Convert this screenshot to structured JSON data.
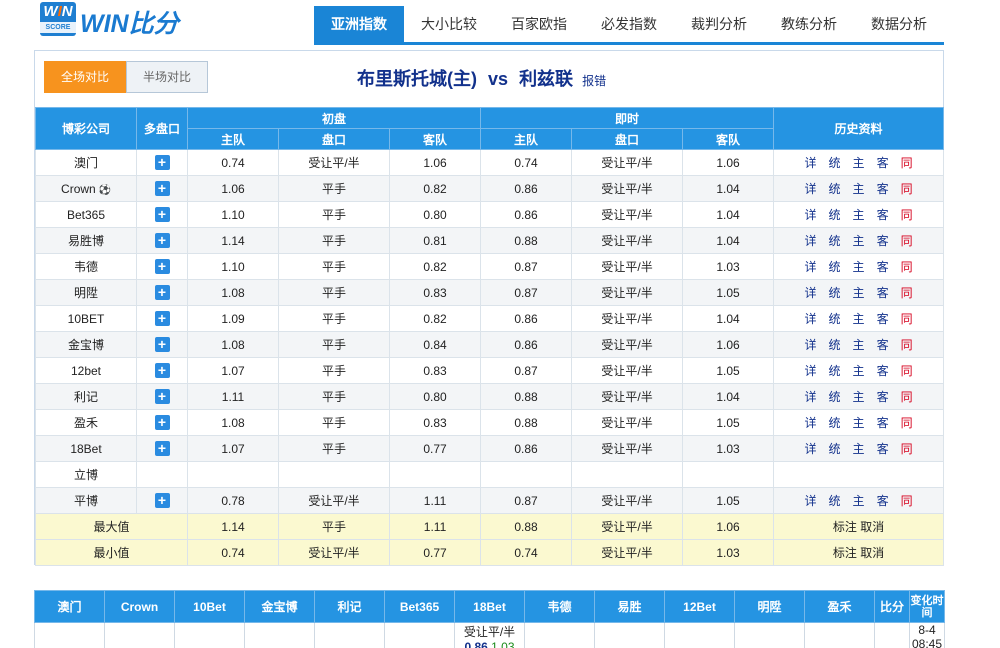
{
  "logo": {
    "win_prefix": "W",
    "win_i": "I",
    "win_suffix": "N",
    "score": "SCORE",
    "text": "WIN比分"
  },
  "nav": [
    "亚洲指数",
    "大小比较",
    "百家欧指",
    "必发指数",
    "裁判分析",
    "教练分析",
    "数据分析"
  ],
  "tabs": {
    "full": "全场对比",
    "half": "半场对比"
  },
  "match": {
    "home": "布里斯托城(主)",
    "vs": "vs",
    "away": "利兹联",
    "report": "报错"
  },
  "table": {
    "h_company": "博彩公司",
    "h_multi": "多盘口",
    "h_initial": "初盘",
    "h_live": "即时",
    "h_history": "历史资料",
    "h_home": "主队",
    "h_line": "盘口",
    "h_away": "客队"
  },
  "history_links": [
    "详",
    "统",
    "主",
    "客",
    "同"
  ],
  "rows": [
    {
      "company": "澳门",
      "plus": true,
      "i_home": "0.74",
      "i_line": "受让平/半",
      "i_away": "1.06",
      "l_home": "0.74",
      "l_line": "受让平/半",
      "l_away": "1.06",
      "hist": true
    },
    {
      "company": "Crown",
      "ball": true,
      "plus": true,
      "i_home": "1.06",
      "i_line": "平手",
      "i_away": "0.82",
      "l_home": "0.86",
      "l_line": "受让平/半",
      "l_away": "1.04",
      "hist": true
    },
    {
      "company": "Bet365",
      "plus": true,
      "i_home": "1.10",
      "i_line": "平手",
      "i_away": "0.80",
      "l_home": "0.86",
      "l_line": "受让平/半",
      "l_away": "1.04",
      "hist": true
    },
    {
      "company": "易胜博",
      "plus": true,
      "i_home": "1.14",
      "i_line": "平手",
      "i_away": "0.81",
      "l_home": "0.88",
      "l_line": "受让平/半",
      "l_away": "1.04",
      "hist": true
    },
    {
      "company": "韦德",
      "plus": true,
      "i_home": "1.10",
      "i_line": "平手",
      "i_away": "0.82",
      "l_home": "0.87",
      "l_line": "受让平/半",
      "l_away": "1.03",
      "hist": true
    },
    {
      "company": "明陞",
      "plus": true,
      "i_home": "1.08",
      "i_line": "平手",
      "i_away": "0.83",
      "l_home": "0.87",
      "l_line": "受让平/半",
      "l_away": "1.05",
      "hist": true
    },
    {
      "company": "10BET",
      "plus": true,
      "i_home": "1.09",
      "i_line": "平手",
      "i_away": "0.82",
      "l_home": "0.86",
      "l_line": "受让平/半",
      "l_away": "1.04",
      "hist": true
    },
    {
      "company": "金宝博",
      "plus": true,
      "i_home": "1.08",
      "i_line": "平手",
      "i_away": "0.84",
      "l_home": "0.86",
      "l_line": "受让平/半",
      "l_away": "1.06",
      "hist": true
    },
    {
      "company": "12bet",
      "plus": true,
      "i_home": "1.07",
      "i_line": "平手",
      "i_away": "0.83",
      "l_home": "0.87",
      "l_line": "受让平/半",
      "l_away": "1.05",
      "hist": true
    },
    {
      "company": "利记",
      "plus": true,
      "i_home": "1.11",
      "i_line": "平手",
      "i_away": "0.80",
      "l_home": "0.88",
      "l_line": "受让平/半",
      "l_away": "1.04",
      "hist": true
    },
    {
      "company": "盈禾",
      "plus": true,
      "i_home": "1.08",
      "i_line": "平手",
      "i_away": "0.83",
      "l_home": "0.88",
      "l_line": "受让平/半",
      "l_away": "1.05",
      "hist": true
    },
    {
      "company": "18Bet",
      "plus": true,
      "i_home": "1.07",
      "i_line": "平手",
      "i_away": "0.77",
      "l_home": "0.86",
      "l_line": "受让平/半",
      "l_away": "1.03",
      "hist": true
    },
    {
      "company": "立博",
      "plus": false,
      "i_home": "",
      "i_line": "",
      "i_away": "",
      "l_home": "",
      "l_line": "",
      "l_away": "",
      "hist": false
    },
    {
      "company": "平博",
      "plus": true,
      "i_home": "0.78",
      "i_line": "受让平/半",
      "i_away": "1.11",
      "l_home": "0.87",
      "l_line": "受让平/半",
      "l_away": "1.05",
      "hist": true
    }
  ],
  "summary": [
    {
      "label": "最大值",
      "i_home": "1.14",
      "i_line": "平手",
      "i_away": "1.11",
      "l_home": "0.88",
      "l_line": "受让平/半",
      "l_away": "1.06",
      "action": "标注 取消"
    },
    {
      "label": "最小值",
      "i_home": "0.74",
      "i_line": "受让平/半",
      "i_away": "0.77",
      "l_home": "0.74",
      "l_line": "受让平/半",
      "l_away": "1.03",
      "action": "标注 取消"
    }
  ],
  "bottom": {
    "headers": [
      "澳门",
      "Crown",
      "10Bet",
      "金宝博",
      "利记",
      "Bet365",
      "18Bet",
      "韦德",
      "易胜",
      "12Bet",
      "明陞",
      "盈禾",
      "比分",
      "变化时间"
    ],
    "cell_18bet": {
      "line": "受让平/半",
      "home": "0.86",
      "away": "1.03"
    },
    "change_time_date": "8-4",
    "change_time_clock": "08:45"
  }
}
